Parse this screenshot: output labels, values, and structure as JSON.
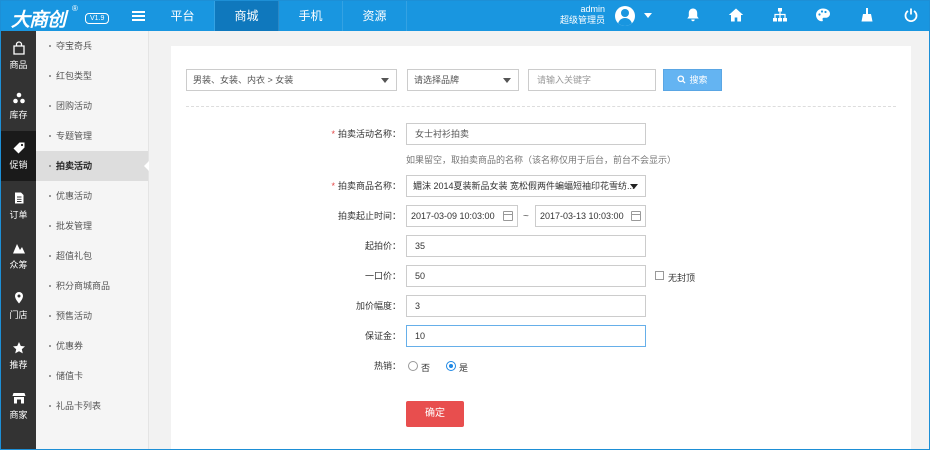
{
  "brand": {
    "logo": "大商创",
    "reg": "®",
    "version": "V1.9"
  },
  "topnav": {
    "tabs": [
      "平台",
      "商城",
      "手机",
      "资源"
    ],
    "active": 1
  },
  "user": {
    "name": "admin",
    "role": "超级管理员"
  },
  "top_icons": [
    "bell-icon",
    "home-icon",
    "sitemap-icon",
    "palette-icon",
    "broom-icon",
    "power-icon"
  ],
  "sidebar": {
    "items": [
      {
        "label": "商品",
        "icon": "goods-icon"
      },
      {
        "label": "库存",
        "icon": "stock-icon"
      },
      {
        "label": "促销",
        "icon": "tag-icon",
        "active": true
      },
      {
        "label": "订单",
        "icon": "order-icon"
      },
      {
        "label": "众筹",
        "icon": "crowdfund-icon"
      },
      {
        "label": "门店",
        "icon": "location-icon"
      },
      {
        "label": "推荐",
        "icon": "star-icon"
      },
      {
        "label": "商家",
        "icon": "store-icon"
      }
    ]
  },
  "submenu": {
    "items": [
      "夺宝奇兵",
      "红包类型",
      "团购活动",
      "专题管理",
      "拍卖活动",
      "优惠活动",
      "批发管理",
      "超值礼包",
      "积分商城商品",
      "预售活动",
      "优惠券",
      "储值卡",
      "礼品卡列表"
    ],
    "active": 4
  },
  "filter": {
    "category": "男装、女装、内衣 > 女装",
    "brand_placeholder": "请选择品牌",
    "keyword_placeholder": "请输入关键字",
    "search_label": "搜索"
  },
  "form": {
    "name_label": "拍卖活动名称：",
    "name_value": "女士衬衫拍卖",
    "name_hint": "如果留空，取拍卖商品的名称（该名称仅用于后台，前台不会显示）",
    "goods_label": "拍卖商品名称：",
    "goods_value": "媚沫 2014夏装新品女装 宽松假两件蝙蝠短袖印花雪纺...",
    "time_label": "拍卖起止时间：",
    "start_time": "2017-03-09 10:03:00",
    "end_time": "2017-03-13 10:03:00",
    "time_sep": "~",
    "start_price_label": "起拍价：",
    "start_price": "35",
    "buyout_label": "一口价：",
    "buyout_price": "50",
    "no_cap_label": "无封顶",
    "increment_label": "加价幅度：",
    "increment": "3",
    "deposit_label": "保证金：",
    "deposit": "10",
    "hot_label": "热销：",
    "hot_no": "否",
    "hot_yes": "是",
    "hot_value": "是",
    "submit_label": "确定"
  },
  "colors": {
    "topbar": "#1996e0",
    "sidebar": "#333333",
    "submit": "#e84e4e",
    "search": "#64b4f2"
  }
}
